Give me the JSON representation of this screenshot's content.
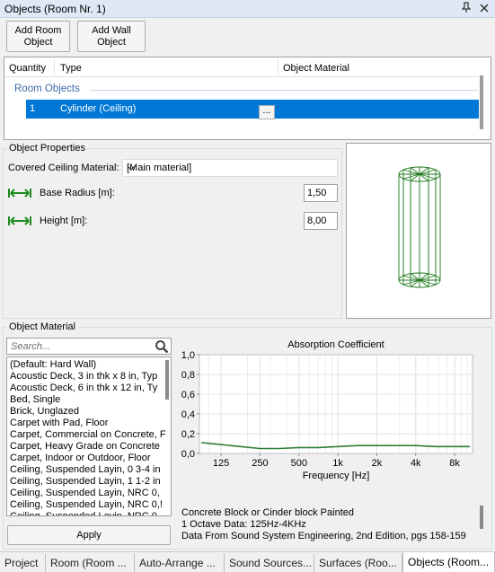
{
  "window": {
    "title": "Objects (Room Nr. 1)",
    "pin_icon": "pin-icon",
    "close_icon": "close-icon"
  },
  "toolbar": {
    "add_room_object": "Add Room\nObject",
    "add_wall_object": "Add Wall\nObject"
  },
  "object_list": {
    "columns": [
      "Quantity",
      "Type",
      "Object Material"
    ],
    "group_label": "Room Objects",
    "rows": [
      {
        "quantity": "1",
        "type": "Cylinder (Ceiling)",
        "material_button": "..."
      }
    ]
  },
  "properties": {
    "section_title": "Object Properties",
    "covered_label": "Covered Ceiling Material:",
    "covered_value": "[Main material]",
    "base_radius_label": "Base Radius [m]:",
    "base_radius_value": "1,50",
    "height_label": "Height [m]:",
    "height_value": "8,00"
  },
  "material": {
    "section_title": "Object Material",
    "search_placeholder": "Search...",
    "items": [
      "(Default: Hard Wall)",
      "Acoustic Deck, 3 in thk x 8 in, Typ",
      "Acoustic Deck, 6 in thk x 12 in, Ty",
      "Bed, Single",
      "Brick, Unglazed",
      "Carpet with Pad, Floor",
      "Carpet, Commercial on Concrete, F",
      "Carpet, Heavy Grade on Concrete",
      "Carpet, Indoor or Outdoor, Floor",
      "Ceiling, Suspended Layin, 0 3-4 in",
      "Ceiling, Suspended Layin, 1 1-2 in",
      "Ceiling, Suspended Layin, NRC 0,",
      "Ceiling, Suspended Layin, NRC 0,!",
      "Ceiling, Suspended Layin, NRC 0,"
    ],
    "apply_label": "Apply",
    "info_lines": [
      "Concrete Block or Cinder block Painted",
      "1 Octave Data: 125Hz-4KHz",
      "Data From Sound System Engineering, 2nd Edition, pgs 158-159"
    ]
  },
  "chart_data": {
    "type": "line",
    "title": "Absorption Coefficient",
    "xlabel": "Frequency [Hz]",
    "ylabel": "",
    "x_scale": "log",
    "x_ticks": [
      "125",
      "250",
      "500",
      "1k",
      "2k",
      "4k",
      "8k"
    ],
    "x_tick_values": [
      125,
      250,
      500,
      1000,
      2000,
      4000,
      8000
    ],
    "y_ticks": [
      "1,0",
      "0,8",
      "0,6",
      "0,4",
      "0,2",
      "0,0"
    ],
    "ylim": [
      0,
      1
    ],
    "grid": true,
    "series": [
      {
        "x": [
          88,
          125,
          177,
          250,
          354,
          500,
          707,
          1000,
          1414,
          2000,
          2828,
          4000,
          5657,
          8000,
          10500
        ],
        "y": [
          0.11,
          0.09,
          0.07,
          0.05,
          0.05,
          0.06,
          0.06,
          0.07,
          0.08,
          0.08,
          0.08,
          0.08,
          0.07,
          0.07,
          0.07
        ],
        "color": "#2e7d32"
      }
    ]
  },
  "tabs": [
    "Project",
    "Room (Room ...",
    "Auto-Arrange ...",
    "Sound Sources...",
    "Surfaces (Roo...",
    "Objects (Room..."
  ],
  "active_tab": 5,
  "colors": {
    "selection": "#0078d7",
    "group_header": "#3c6aa6",
    "wireframe": "#1f7a1f",
    "curve": "#2e7d32"
  }
}
